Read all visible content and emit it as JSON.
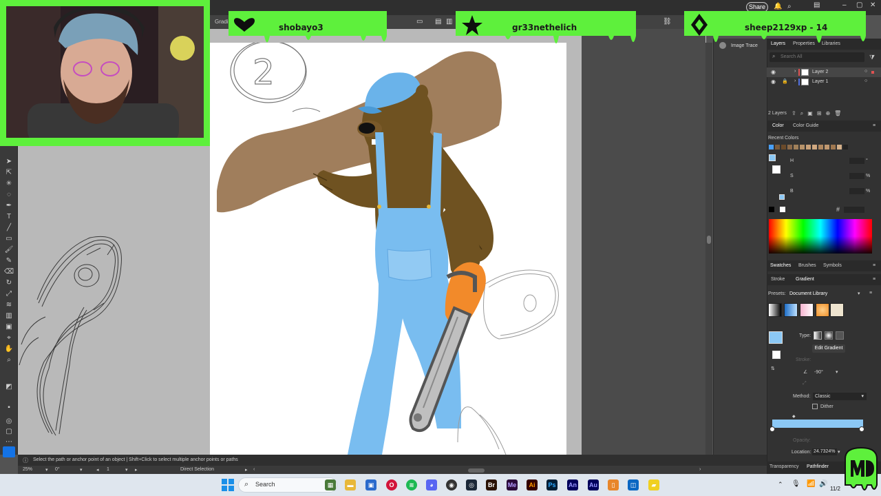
{
  "window": {
    "app_name": "Adobe Illustrator",
    "share_label": "Share",
    "control_label": "Gradient"
  },
  "alerts": [
    {
      "icon": "heart-icon",
      "text": "shobayo3"
    },
    {
      "icon": "star-icon",
      "text": "gr33nethelich"
    },
    {
      "icon": "diamond-icon",
      "text": "sheep2129xp - 14"
    }
  ],
  "mid_panel": {
    "image_trace": "Image Trace"
  },
  "layers": {
    "tabs": [
      "Layers",
      "Properties",
      "Libraries"
    ],
    "search_placeholder": "Search All",
    "rows": [
      {
        "name": "Layer 2",
        "color": "#e05252"
      },
      {
        "name": "Layer 1",
        "color": "#5271e0"
      }
    ],
    "count": "2 Layers"
  },
  "color_panel": {
    "tabs": [
      "Color",
      "Color Guide"
    ],
    "recent_colors_label": "Recent Colors",
    "recent_colors": [
      "#4a9ff5",
      "#7a5a3a",
      "#6a4a2a",
      "#8b6a4a",
      "#a0805a",
      "#b8936a",
      "#c8a078",
      "#d0a880",
      "#b08860",
      "#c09870",
      "#a07850",
      "#d4b08a",
      "#222222"
    ],
    "fields": [
      "H",
      "S",
      "B"
    ],
    "units": [
      "°",
      "%",
      "%"
    ],
    "hex_label": "#"
  },
  "swatch_tabs": [
    "Swatches",
    "Brushes",
    "Symbols"
  ],
  "gradient_panel": {
    "tabs": [
      "Stroke",
      "Gradient"
    ],
    "presets_label": "Presets:",
    "presets_value": "Document Library",
    "type_label": "Type:",
    "edit_gradient": "Edit Gradient",
    "stroke_label": "Stroke:",
    "angle": "-90°",
    "method_label": "Method:",
    "method_value": "Classic",
    "dither_label": "Dither",
    "opacity_label": "Opacity:",
    "location_label": "Location:",
    "location_value": "24.7324%",
    "stop_color": "#8bc8f5"
  },
  "bottom_tabs": [
    "Transparency",
    "Pathfinder"
  ],
  "status": {
    "hint": "Select the path or anchor point of an object  |  Shift+Click to select multiple anchor points or paths",
    "zoom": "25%",
    "rotation": "0°",
    "artboard": "1",
    "tool": "Direct Selection"
  },
  "taskbar": {
    "search_label": "Search",
    "apps": [
      "Br",
      "Me",
      "Ai",
      "Ps",
      "An",
      "Au"
    ],
    "time": "11/2"
  },
  "artwork": {
    "sketch_number": "2"
  }
}
